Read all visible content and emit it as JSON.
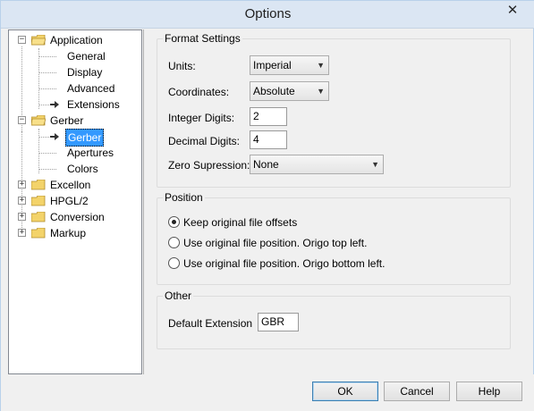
{
  "window": {
    "title": "Options",
    "close_glyph": "✕"
  },
  "tree": {
    "items": [
      {
        "label": "Application",
        "level": 0,
        "expander": "−",
        "selected": false
      },
      {
        "label": "General",
        "level": 1,
        "selected": false
      },
      {
        "label": "Display",
        "level": 1,
        "selected": false
      },
      {
        "label": "Advanced",
        "level": 1,
        "selected": false
      },
      {
        "label": "Extensions",
        "level": 1,
        "selected": false
      },
      {
        "label": "Gerber",
        "level": 0,
        "expander": "−",
        "selected": false
      },
      {
        "label": "Gerber",
        "level": 1,
        "selected": true
      },
      {
        "label": "Apertures",
        "level": 1,
        "selected": false
      },
      {
        "label": "Colors",
        "level": 1,
        "selected": false
      },
      {
        "label": "Excellon",
        "level": 0,
        "expander": "+",
        "selected": false
      },
      {
        "label": "HPGL/2",
        "level": 0,
        "expander": "+",
        "selected": false
      },
      {
        "label": "Conversion",
        "level": 0,
        "expander": "+",
        "selected": false
      },
      {
        "label": "Markup",
        "level": 0,
        "expander": "+",
        "selected": false
      }
    ]
  },
  "format_settings": {
    "title": "Format Settings",
    "units_label": "Units:",
    "units_value": "Imperial",
    "coordinates_label": "Coordinates:",
    "coordinates_value": "Absolute",
    "integer_digits_label": "Integer Digits:",
    "integer_digits_value": "2",
    "decimal_digits_label": "Decimal Digits:",
    "decimal_digits_value": "4",
    "zero_supression_label": "Zero Supression:",
    "zero_supression_value": "None"
  },
  "position": {
    "title": "Position",
    "options": [
      {
        "label": "Keep original file offsets",
        "checked": true
      },
      {
        "label": "Use original file position. Origo top left.",
        "checked": false
      },
      {
        "label": "Use original file position. Origo bottom left.",
        "checked": false
      }
    ]
  },
  "other": {
    "title": "Other",
    "default_extension_label": "Default Extension",
    "default_extension_value": "GBR"
  },
  "buttons": {
    "ok": "OK",
    "cancel": "Cancel",
    "help": "Help"
  },
  "colors": {
    "selection": "#3399ff",
    "titlebar": "#dbe6f3",
    "folder": "#f3d36a"
  }
}
